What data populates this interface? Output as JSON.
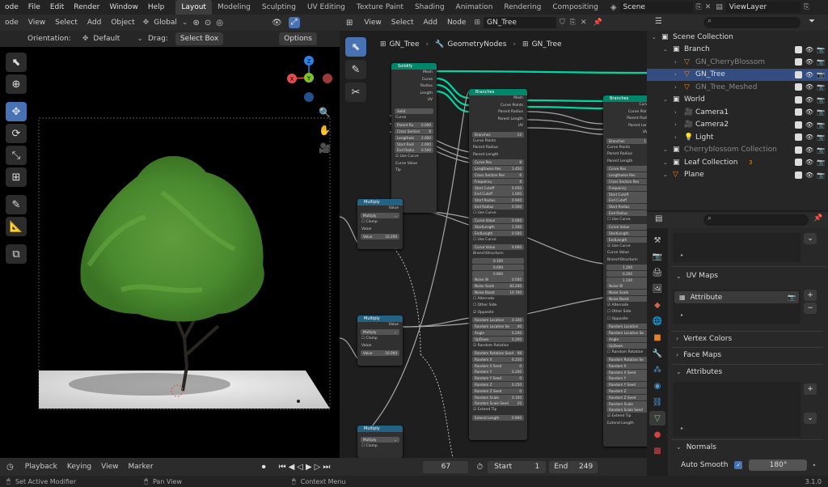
{
  "topbar": {
    "menu": [
      "ode",
      "File",
      "Edit",
      "Render",
      "Window",
      "Help"
    ],
    "workspaces": [
      "Layout",
      "Modeling",
      "Sculpting",
      "UV Editing",
      "Texture Paint",
      "Shading",
      "Animation",
      "Rendering",
      "Compositing"
    ],
    "active_workspace": "Layout",
    "scene": "Scene",
    "view_layer": "ViewLayer"
  },
  "viewport": {
    "header": {
      "mode": "ode",
      "menus": [
        "View",
        "Select",
        "Add",
        "Object"
      ],
      "transform": "Global"
    },
    "subheader": {
      "orientation_label": "Orientation:",
      "orientation_value": "Default",
      "drag_label": "Drag:",
      "drag_value": "Select Box",
      "options": "Options"
    },
    "gizmo": {
      "x": "X",
      "y": "Y",
      "z": "Z"
    }
  },
  "node_editor": {
    "header": {
      "menus": [
        "View",
        "Select",
        "Add",
        "Node"
      ],
      "tree_name": "GN_Tree"
    },
    "breadcrumb": [
      "GN_Tree",
      "GeometryNodes",
      "GN_Tree"
    ],
    "nodes": {
      "solidify": {
        "title": "Solidify",
        "outputs": [
          "Mesh",
          "Curve",
          "Radius",
          "Length",
          "UV"
        ],
        "inputs": [
          "Curve"
        ],
        "fields": [
          [
            "Parent Ra",
            "0.000"
          ],
          [
            "Cross Section",
            "8"
          ],
          [
            "Lengthwis",
            "2.000"
          ],
          [
            "Start Radi",
            "2.000"
          ],
          [
            "End Radiu",
            "0.500"
          ]
        ],
        "bools": [
          "Use Curve"
        ],
        "more": [
          "Curve Value",
          "Tip"
        ],
        "solid": "Solid."
      },
      "branches1": {
        "title": "Branches",
        "outputs": [
          "Mesh",
          "Curve Points",
          "Parent Radius",
          "Parent Length",
          "UV"
        ],
        "group": "Branches",
        "group_num": "14",
        "inputs": [
          "Curve Points",
          "Parent Radius",
          "Parent Length"
        ],
        "fields": [
          [
            "Curve Res",
            "8"
          ],
          [
            "Lengthwise Res",
            "1.450"
          ],
          [
            "Cross Section Res",
            "6"
          ],
          [
            "Frequency",
            "8"
          ],
          [
            "Start Cutoff",
            "0.050"
          ],
          [
            "End Cutoff",
            "1.000"
          ],
          [
            "Start Radius",
            "0.900"
          ],
          [
            "End Radius",
            "0.500"
          ]
        ],
        "use_curve": "Use Curve",
        "fields2": [
          [
            "Curve Value",
            "0.000"
          ],
          [
            "StartLength",
            "1.500"
          ],
          [
            "EndLength",
            "0.500"
          ]
        ],
        "use_curve2": "Use Curve",
        "curve_value": [
          "Curve Value",
          "0.000"
        ],
        "branch_structure": "BranchStructure:",
        "bs_vals": [
          "0.100",
          "0.600",
          "0.800"
        ],
        "fields3": [
          [
            "Noise W",
            "0.000"
          ],
          [
            "Noise Scale",
            "83.200"
          ],
          [
            "Noise Boost",
            "10.700"
          ]
        ],
        "bools": [
          "Alternate",
          "Other Side",
          "Opposite"
        ],
        "fields4": [
          [
            "Random Location",
            "0.100"
          ],
          [
            "Random Location Se",
            "40"
          ],
          [
            "Angle",
            "0.200"
          ],
          [
            "UpDown",
            "0.200"
          ]
        ],
        "rand_rot": "Random Rotation",
        "fields5": [
          [
            "Random Rotation Seed",
            "98"
          ],
          [
            "Random X",
            "0.250"
          ],
          [
            "Random X Seed",
            "0"
          ],
          [
            "Random Y",
            "0.200"
          ],
          [
            "Random Y Seed",
            "0"
          ],
          [
            "Random Z",
            "0.250"
          ],
          [
            "Random Z Seed",
            "0"
          ],
          [
            "Random Scale",
            "0.100"
          ],
          [
            "Random Scale Seed",
            "20"
          ]
        ],
        "extend_tip": "Extend Tip",
        "extend_len": [
          "Extend Length",
          "0.900"
        ]
      },
      "branches2": {
        "title": "Branches",
        "outputs": [
          "Curv",
          "Curve Poin",
          "Parent Radi",
          "Parent Len",
          "UV"
        ],
        "group": "Branches",
        "group_num": "1",
        "inputs": [
          "Curve Points",
          "Parent Radius",
          "Parent Length"
        ],
        "fields": [
          [
            "Curve Res",
            ""
          ],
          [
            "Lengthwise Res",
            ""
          ],
          [
            "Cross Section Res",
            ""
          ],
          [
            "Frequency",
            ""
          ],
          [
            "Start Cutoff",
            ""
          ],
          [
            "End Cutoff",
            ""
          ],
          [
            "Start Radius",
            ""
          ],
          [
            "End Radius",
            ""
          ]
        ],
        "use_curve": "Use Curve",
        "fields2": [
          [
            "Curve Value",
            ""
          ],
          [
            "StartLength",
            ""
          ],
          [
            "EndLength",
            ""
          ]
        ],
        "use_curve2": "Use Curve",
        "curve_value_lbl": "Curve Value",
        "branch_structure": "BranchStructure:",
        "bs_vals": [
          "1.200",
          "0.200",
          "1.100"
        ],
        "fields3": [
          [
            "Noise W",
            ""
          ],
          [
            "Noise Scale",
            ""
          ],
          [
            "Noise Boost",
            ""
          ]
        ],
        "bools": [
          "Alternate",
          "Other Side",
          "Opposite"
        ],
        "fields4": [
          [
            "Random Location",
            ""
          ],
          [
            "Random Location Se",
            ""
          ],
          [
            "Angle",
            ""
          ],
          [
            "UpDown",
            ""
          ]
        ],
        "rand_rot": "Random Rotation",
        "fields5": [
          [
            "Random Rotation Se",
            ""
          ],
          [
            "Random X",
            ""
          ],
          [
            "Random X Seed",
            ""
          ],
          [
            "Random Y",
            ""
          ],
          [
            "Random Y Seed",
            ""
          ],
          [
            "Random Z",
            ""
          ],
          [
            "Random Z Seed",
            ""
          ],
          [
            "Random Scale",
            ""
          ],
          [
            "Random Scale Seed",
            ""
          ]
        ],
        "extend_tip": "Extend Tip",
        "extend_len_lbl": "Extend Length"
      },
      "multiply1": {
        "title": "Multiply",
        "out": "Value",
        "op": "Multiply",
        "clamp": "Clamp",
        "in": "Value",
        "val_label": "Value",
        "val": "10.200"
      },
      "multiply2": {
        "title": "Multiply",
        "out": "Value",
        "op": "Multiply",
        "clamp": "Clamp",
        "in": "Value",
        "val_label": "Value",
        "val": "16.000"
      },
      "multiply3": {
        "title": "Multiply",
        "out": "Value",
        "op": "Multiply",
        "clamp": "Clamp"
      }
    }
  },
  "outliner": {
    "search_placeholder": "",
    "items": [
      {
        "label": "Scene Collection",
        "indent": 0,
        "icon": "collection-icon",
        "sel": false
      },
      {
        "label": "Branch",
        "indent": 1,
        "icon": "collection-icon",
        "sel": false
      },
      {
        "label": "GN_CherryBlossom",
        "indent": 2,
        "icon": "mesh-icon",
        "sel": false,
        "dim": true
      },
      {
        "label": "GN_Tree",
        "indent": 2,
        "icon": "mesh-icon",
        "sel": true
      },
      {
        "label": "GN_Tree_Meshed",
        "indent": 2,
        "icon": "mesh-icon",
        "sel": false,
        "dim": true
      },
      {
        "label": "World",
        "indent": 1,
        "icon": "collection-icon",
        "sel": false
      },
      {
        "label": "Camera1",
        "indent": 2,
        "icon": "camera-icon",
        "sel": false
      },
      {
        "label": "Camera2",
        "indent": 2,
        "icon": "camera-icon",
        "sel": false
      },
      {
        "label": "Light",
        "indent": 2,
        "icon": "light-icon",
        "sel": false
      },
      {
        "label": "Cherryblossom Collection",
        "indent": 1,
        "icon": "collection-icon",
        "sel": false,
        "dim": true
      },
      {
        "label": "Leaf Collection",
        "indent": 1,
        "icon": "collection-icon",
        "sel": false,
        "badge": "3"
      },
      {
        "label": "Plane",
        "indent": 1,
        "icon": "mesh-icon",
        "sel": false
      }
    ]
  },
  "properties": {
    "uv_maps": "UV Maps",
    "uv_attr": "Attribute",
    "vertex_colors": "Vertex Colors",
    "face_maps": "Face Maps",
    "attributes": "Attributes",
    "normals": "Normals",
    "auto_smooth": "Auto Smooth",
    "angle": "180°"
  },
  "timeline": {
    "menus": [
      "Playback",
      "Keying",
      "View",
      "Marker"
    ],
    "frame": "67",
    "start_label": "Start",
    "start": "1",
    "end_label": "End",
    "end": "249"
  },
  "status": {
    "items": [
      "Set Active Modifier",
      "Pan View",
      "Context Menu"
    ],
    "version": "3.1.0"
  },
  "colors": {
    "accent": "#4772b3",
    "geo_header": "#00866b",
    "math_header": "#246283",
    "geo_wire": "#00d6a3",
    "selected_row": "#334d80"
  }
}
